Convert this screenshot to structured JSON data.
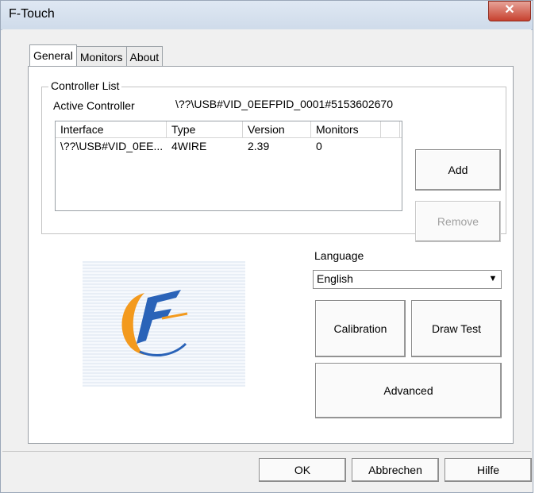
{
  "window": {
    "title": "F-Touch",
    "close_glyph": "✕"
  },
  "tabs": [
    {
      "label": "General",
      "active": true
    },
    {
      "label": "Monitors",
      "active": false
    },
    {
      "label": "About",
      "active": false
    }
  ],
  "controller_list": {
    "group_label": "Controller List",
    "active_label": "Active Controller",
    "active_value": "\\??\\USB#VID_0EEFPID_0001#5153602670",
    "columns": [
      "Interface",
      "Type",
      "Version",
      "Monitors"
    ],
    "rows": [
      {
        "interface": "\\??\\USB#VID_0EE...",
        "type": "4WIRE",
        "version": "2.39",
        "monitors": "0"
      }
    ],
    "add_label": "Add",
    "remove_label": "Remove"
  },
  "language": {
    "label": "Language",
    "value": "English"
  },
  "buttons": {
    "calibration": "Calibration",
    "draw_test": "Draw Test",
    "advanced": "Advanced"
  },
  "dialog": {
    "ok": "OK",
    "cancel": "Abbrechen",
    "help": "Hilfe"
  },
  "colors": {
    "logo_orange": "#f39a1e",
    "logo_blue": "#2a63b8"
  },
  "icons": {
    "logo": "f-touch-logo-icon",
    "dropdown": "chevron-down-icon"
  }
}
